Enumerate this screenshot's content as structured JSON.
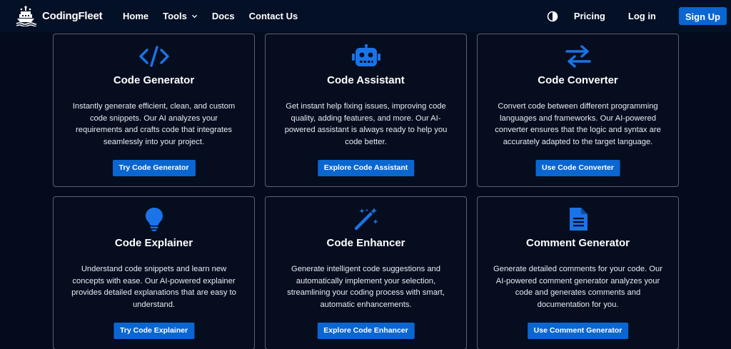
{
  "brand": {
    "name": "CodingFleet",
    "logo": "ship-logo"
  },
  "nav": {
    "home": "Home",
    "tools": "Tools",
    "docs": "Docs",
    "contact": "Contact Us",
    "pricing": "Pricing",
    "login": "Log in",
    "signup": "Sign Up"
  },
  "colors": {
    "accent": "#0a66d1",
    "background": "#030b1c",
    "card_border": "#5b6270",
    "icon": "#1a73e8"
  },
  "cards": [
    {
      "icon": "code-icon",
      "title": "Code Generator",
      "description": "Instantly generate efficient, clean, and custom code snippets. Our AI analyzes your requirements and crafts code that integrates seamlessly into your project.",
      "button": "Try Code Generator"
    },
    {
      "icon": "robot-icon",
      "title": "Code Assistant",
      "description": "Get instant help fixing issues, improving code quality, adding features, and more. Our AI-powered assistant is always ready to help you code better.",
      "button": "Explore Code Assistant"
    },
    {
      "icon": "arrows-exchange-icon",
      "title": "Code Converter",
      "description": "Convert code between different programming languages and frameworks. Our AI-powered converter ensures that the logic and syntax are accurately adapted to the target language.",
      "button": "Use Code Converter"
    },
    {
      "icon": "lightbulb-icon",
      "title": "Code Explainer",
      "description": "Understand code snippets and learn new concepts with ease. Our AI-powered explainer provides detailed explanations that are easy to understand.",
      "button": "Try Code Explainer"
    },
    {
      "icon": "magic-wand-icon",
      "title": "Code Enhancer",
      "description": "Generate intelligent code suggestions and automatically implement your selection, streamlining your coding process with smart, automatic enhancements.",
      "button": "Explore Code Enhancer"
    },
    {
      "icon": "document-icon",
      "title": "Comment Generator",
      "description": "Generate detailed comments for your code. Our AI-powered comment generator analyzes your code and generates comments and documentation for you.",
      "button": "Use Comment Generator"
    }
  ]
}
